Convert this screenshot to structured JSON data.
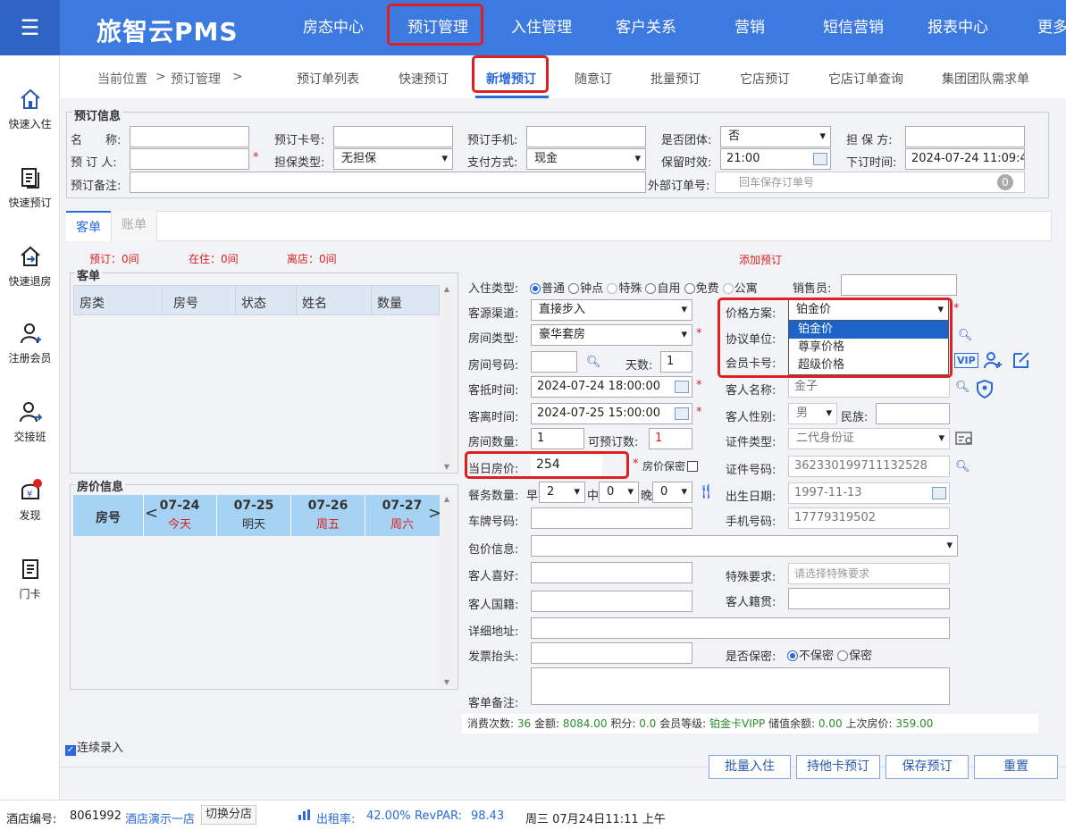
{
  "app": {
    "title": "旅智云PMS"
  },
  "nav": [
    "房态中心",
    "预订管理",
    "入住管理",
    "客户关系",
    "营销",
    "短信营销",
    "报表中心",
    "更多"
  ],
  "sidebar": [
    "快速入住",
    "快速预订",
    "快速退房",
    "注册会员",
    "交接班",
    "发现",
    "门卡"
  ],
  "breadcrumb": {
    "label": "当前位置",
    "sep": ">",
    "page": "预订管理",
    "sep2": ">"
  },
  "subtabs": [
    "预订单列表",
    "快速预订",
    "新增预订",
    "随意订",
    "批量预订",
    "它店预订",
    "它店订单查询",
    "集团团队需求单"
  ],
  "booking": {
    "section": "预订信息",
    "name_label": "名　　称:",
    "card_label": "预订卡号:",
    "phone_label": "预订手机:",
    "group_label": "是否团体:",
    "group_value": "否",
    "guarantor_label": "担 保 方:",
    "booker_label": "预 订 人:",
    "guarantee_type_label": "担保类型:",
    "guarantee_type_value": "无担保",
    "pay_label": "支付方式:",
    "pay_value": "现金",
    "hold_label": "保留时效:",
    "hold_value": "21:00",
    "order_time_label": "下订时间:",
    "order_time_value": "2024-07-24 11:09:4",
    "remark_label": "预订备注:",
    "ext_label": "外部订单号:",
    "ext_placeholder": "回车保存订单号",
    "ext_count": "0"
  },
  "tabs": [
    "客单",
    "账单"
  ],
  "summary": {
    "reserved": "预订：0间",
    "checked_in": "在住：0间",
    "departed": "离店：0间",
    "add": "添加预订"
  },
  "guest_table": {
    "title": "客单",
    "headers": [
      "房类",
      "房号",
      "状态",
      "姓名",
      "数量"
    ]
  },
  "price_table": {
    "title": "房价信息",
    "room_label": "房号",
    "dates": [
      {
        "date": "07-24",
        "day": "今天"
      },
      {
        "date": "07-25",
        "day": "明天"
      },
      {
        "date": "07-26",
        "day": "周五"
      },
      {
        "date": "07-27",
        "day": "周六"
      }
    ]
  },
  "form": {
    "checkin_type_label": "入住类型:",
    "checkin_types": [
      "普通",
      "钟点",
      "特殊",
      "自用",
      "免费",
      "公寓"
    ],
    "sales_label": "销售员:",
    "channel_label": "客源渠道:",
    "channel_value": "直接步入",
    "price_plan_label": "价格方案:",
    "price_plan_value": "铂金价",
    "price_options": [
      "铂金价",
      "尊享价格",
      "超级价格"
    ],
    "room_type_label": "房间类型:",
    "room_type_value": "豪华套房",
    "agreement_label": "协议单位:",
    "room_no_label": "房间号码:",
    "days_label": "天数:",
    "days_value": "1",
    "member_card_label": "会员卡号:",
    "vip": "VIP",
    "arrive_label": "客抵时间:",
    "arrive_value": "2024-07-24 18:00:00",
    "guest_name_label": "客人名称:",
    "guest_name_value": "金子",
    "depart_label": "客离时间:",
    "depart_value": "2024-07-25 15:00:00",
    "gender_label": "客人性别:",
    "gender_value": "男",
    "ethnic_label": "民族:",
    "room_count_label": "房间数量:",
    "room_count_value": "1",
    "available_label": "可预订数:",
    "available_value": "1",
    "id_type_label": "证件类型:",
    "id_type_value": "二代身份证",
    "price_label": "当日房价:",
    "price_value": "254",
    "secret_price_label": "房价保密",
    "id_no_label": "证件号码:",
    "id_no_value": "362330199711132528",
    "meal_label": "餐务数量:",
    "breakfast": "早",
    "breakfast_value": "2",
    "lunch": "中",
    "lunch_value": "0",
    "dinner": "晚",
    "dinner_value": "0",
    "birth_label": "出生日期:",
    "birth_value": "1997-11-13",
    "plate_label": "车牌号码:",
    "mobile_label": "手机号码:",
    "mobile_value": "17779319502",
    "package_label": "包价信息:",
    "pref_label": "客人喜好:",
    "special_label": "特殊要求:",
    "special_placeholder": "请选择特殊要求",
    "nationality_label": "客人国籍:",
    "origin_label": "客人籍贯:",
    "address_label": "详细地址:",
    "invoice_label": "发票抬头:",
    "secret_label": "是否保密:",
    "no_secret": "不保密",
    "secret": "保密",
    "remark_label": "客单备注:"
  },
  "stats": {
    "visits_label": "消费次数:",
    "visits": "36",
    "amount_label": "金额:",
    "amount": "8084.00",
    "points_label": "积分:",
    "points": "0.0",
    "level_label": "会员等级:",
    "level": "铂金卡VIPP",
    "balance_label": "储值余额:",
    "balance": "0.00",
    "last_price_label": "上次房价:",
    "last_price": "359.00"
  },
  "continuous": "连续录入",
  "buttons": [
    "批量入住",
    "持他卡预订",
    "保存预订",
    "重置"
  ],
  "status": {
    "hotel_label": "酒店编号:",
    "hotel_no": "8061992",
    "hotel_name": "酒店演示一店",
    "switch": "切换分店",
    "occupancy_label": "出租率:",
    "occupancy": "42.00%",
    "revpar_label": "RevPAR:",
    "revpar": "98.43",
    "datetime": "周三 07月24日11:11 上午"
  },
  "colors": {
    "topbar": "#3d7ae0",
    "highlight": "#e02020",
    "accent": "#2a6ad9"
  }
}
